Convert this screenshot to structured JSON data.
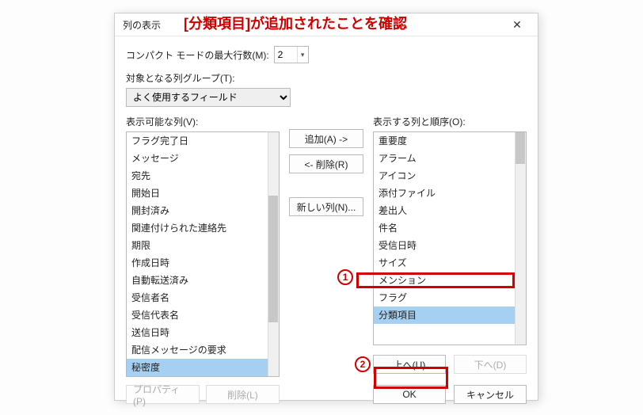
{
  "annotation": {
    "headline": "[分類項目]が追加されたことを確認",
    "circle1": "1",
    "circle2": "2"
  },
  "dialog": {
    "title": "列の表示",
    "close_glyph": "✕",
    "compact_label": "コンパクト モードの最大行数(M):",
    "compact_value": "2",
    "group_label": "対象となる列グループ(T):",
    "group_selected": "よく使用するフィールド",
    "available_label": "表示可能な列(V):",
    "shown_label": "表示する列と順序(O):",
    "buttons": {
      "add": "追加(A) ->",
      "remove": "<- 削除(R)",
      "newcol": "新しい列(N)...",
      "properties": "プロパティ(P)",
      "delete": "削除(L)",
      "up": "上へ(U)",
      "down": "下へ(D)",
      "ok": "OK",
      "cancel": "キャンセル"
    },
    "available_items": [
      "フラグ完了日",
      "メッセージ",
      "宛先",
      "開始日",
      "開封済み",
      "関連付けられた連絡先",
      "期限",
      "作成日時",
      "自動転送済み",
      "受信者名",
      "受信代表名",
      "送信日時",
      "配信メッセージの要求",
      "秘密度"
    ],
    "available_selected_index": 13,
    "shown_items": [
      "重要度",
      "アラーム",
      "アイコン",
      "添付ファイル",
      "差出人",
      "件名",
      "受信日時",
      "サイズ",
      "メンション",
      "フラグ",
      "分類項目"
    ],
    "shown_selected_index": 10
  }
}
